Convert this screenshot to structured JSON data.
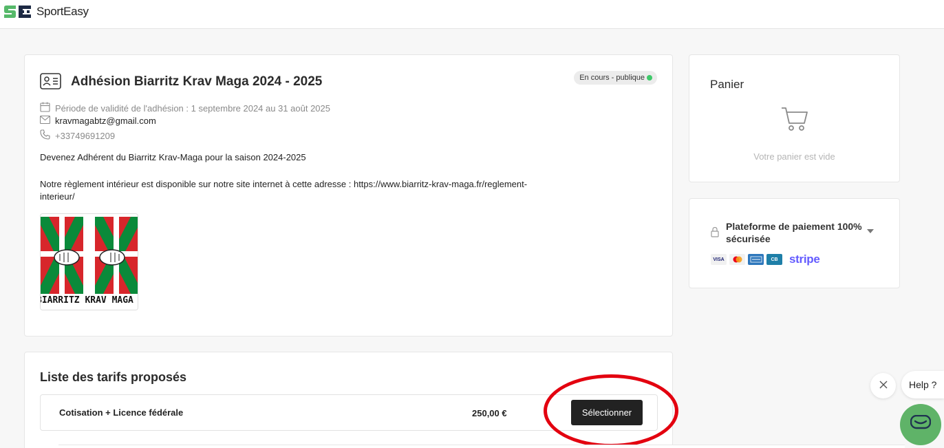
{
  "header": {
    "logo_text": "SportEasy"
  },
  "membership": {
    "title": "Adhésion Biarritz Krav Maga 2024 - 2025",
    "status": "En cours - publique",
    "validity": "Période de validité de l'adhésion : 1 septembre 2024 au 31 août 2025",
    "email": "kravmagabtz@gmail.com",
    "phone": "+33749691209",
    "description_line1": "Devenez Adhérent du Biarritz Krav-Maga pour la saison 2024-2025",
    "description_line2": "Notre règlement intérieur est disponible sur notre site internet à cette adresse : https://www.biarritz-krav-maga.fr/reglement-interieur/",
    "image_text": "BIARRITZ KRAV MAGA"
  },
  "tarifs": {
    "title": "Liste des tarifs proposés",
    "items": [
      {
        "name": "Cotisation + Licence fédérale",
        "price": "250,00 €",
        "button": "Sélectionner"
      }
    ]
  },
  "cart": {
    "title": "Panier",
    "empty_text": "Votre panier est vide"
  },
  "payment": {
    "title": "Plateforme de paiement 100% sécurisée",
    "methods": [
      "visa",
      "mastercard",
      "amex",
      "cb"
    ],
    "visa_label": "VISA",
    "cb_label": "CB",
    "provider": "stripe"
  },
  "help": {
    "label": "Help ?"
  },
  "colors": {
    "accent_green": "#5fb368",
    "status_dot": "#3fc96a",
    "annotation_red": "#e3000f",
    "stripe": "#635bff"
  }
}
